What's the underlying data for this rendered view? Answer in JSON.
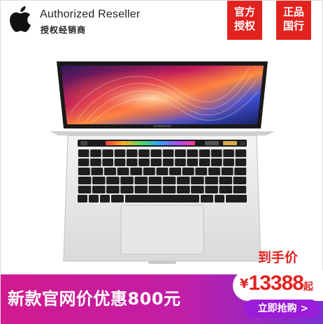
{
  "header": {
    "reseller_en": "Authorized Reseller",
    "reseller_cn": "授权经销商",
    "badges": [
      {
        "line1": "官方",
        "line2": "授权"
      },
      {
        "line1": "正品",
        "line2": "国行"
      }
    ]
  },
  "product": {
    "brand_logo": "apple-logo-icon",
    "image": "macbook-pro-touch-bar"
  },
  "promo": {
    "headline": "新款官网价优惠800元",
    "price_label": "到手价",
    "currency": "¥",
    "price": "13388",
    "price_suffix": "起",
    "cta_label": "立即抢购 >"
  },
  "colors": {
    "brand_red": "#e2221f",
    "banner_magenta": "#d11a8f",
    "banner_purple": "#7b2fd6",
    "cta_purple": "#9a1bd8"
  }
}
